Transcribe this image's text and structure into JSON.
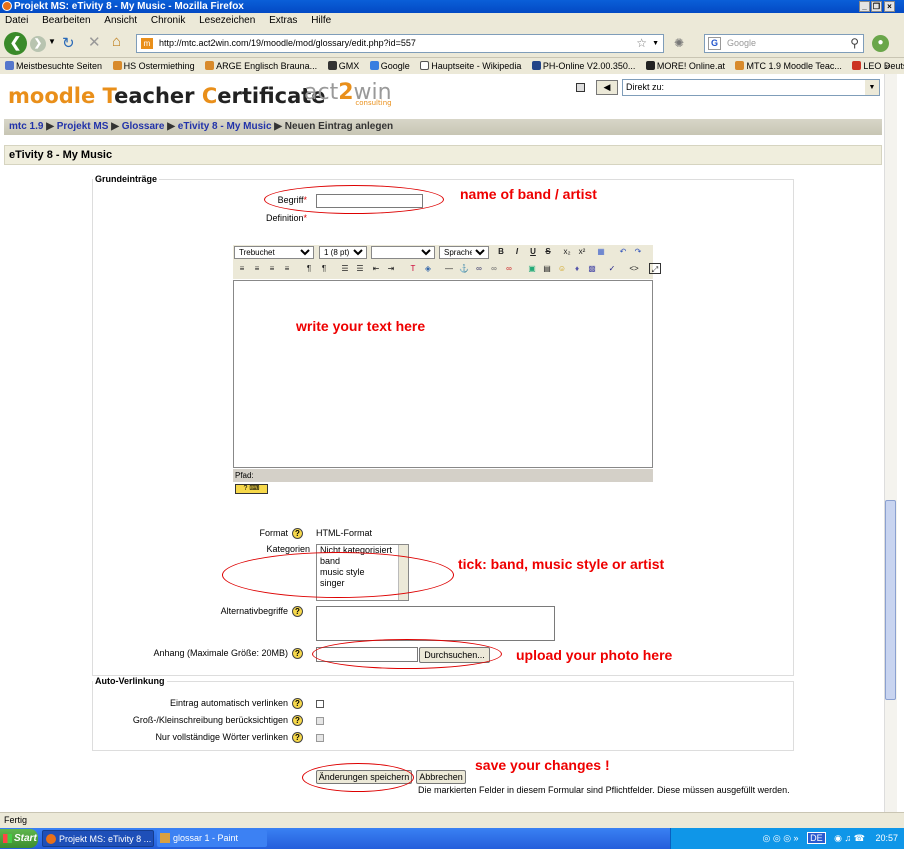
{
  "window": {
    "title": "Projekt MS: eTivity 8 - My Music - Mozilla Firefox",
    "min": "_",
    "max": "❐",
    "close": "×"
  },
  "menubar": [
    "Datei",
    "Bearbeiten",
    "Ansicht",
    "Chronik",
    "Lesezeichen",
    "Extras",
    "Hilfe"
  ],
  "toolbar": {
    "url": "http://mtc.act2win.com/19/moodle/mod/glossary/edit.php?id=557",
    "search_engine": "G",
    "search_placeholder": "Google",
    "site_icon": "m"
  },
  "bookmarks": [
    "Meistbesuchte Seiten",
    "HS Ostermiething",
    "ARGE Englisch Brauna...",
    "GMX",
    "Google",
    "Hauptseite - Wikipedia",
    "PH-Online V2.00.350...",
    "MORE! Online.at",
    "MTC 1.9 Moodle Teac...",
    "LEO Deutsch-Englisch..."
  ],
  "bookmarks_more": "»",
  "header": {
    "logo_m": "m",
    "logo_oodle": "oodle ",
    "logo_T": "T",
    "logo_eacher": "eacher ",
    "logo_C": "C",
    "logo_ertificate": "ertificate",
    "partner_a": "act",
    "partner_2": "2",
    "partner_win": "win",
    "partner_sub": "consulting",
    "jump_label": "Direkt zu:",
    "prev_icon": "◀",
    "dropdown_arrow": "▼"
  },
  "breadcrumb": {
    "items": [
      "mtc 1.9",
      "Projekt MS",
      "Glossare",
      "eTivity 8 - My Music"
    ],
    "sep": "▶",
    "current": "Neuen Eintrag anlegen"
  },
  "page_heading": "eTivity 8 - My Music",
  "form": {
    "legend_main": "Grundeinträge",
    "concept_label": "Begriff",
    "definition_label": "Definition",
    "required_mark": "*",
    "editor": {
      "font": "Trebuchet",
      "size": "1 (8 pt)",
      "style": "",
      "lang": "Sprache",
      "path_label": "Pfad:",
      "help_icon": "? ⌨"
    },
    "format_label": "Format",
    "format_value": "HTML-Format",
    "categories_label": "Kategorien",
    "categories": [
      "Nicht kategorisiert",
      "band",
      "music style",
      "singer"
    ],
    "aliases_label": "Alternativbegriffe",
    "attachment_label": "Anhang (Maximale Größe: 20MB)",
    "browse_button": "Durchsuchen...",
    "legend_autolink": "Auto-Verlinkung",
    "autolink_label": "Eintrag automatisch verlinken",
    "casesensitive_label": "Groß-/Kleinschreibung berücksichtigen",
    "fullmatch_label": "Nur vollständige Wörter verlinken",
    "save_button": "Änderungen speichern",
    "cancel_button": "Abbrechen",
    "required_note": "Die markierten Felder in diesem Formular sind Pflichtfelder. Diese müssen ausgefüllt werden.",
    "help": "?"
  },
  "annotations": {
    "band": "name of band / artist",
    "text": "write your text here",
    "tick": "tick:  band, music style or artist",
    "upload": "upload your photo here",
    "save": "save your changes !"
  },
  "status": "Fertig",
  "taskbar": {
    "start": "Start",
    "tasks": [
      "Projekt MS: eTivity 8 ...",
      "glossar 1 - Paint"
    ],
    "lang": "DE",
    "time": "20:57"
  },
  "colors": {
    "accent": "#e98f1a",
    "annotation": "#e00000",
    "breadcrumb_link": "#2233aa"
  }
}
